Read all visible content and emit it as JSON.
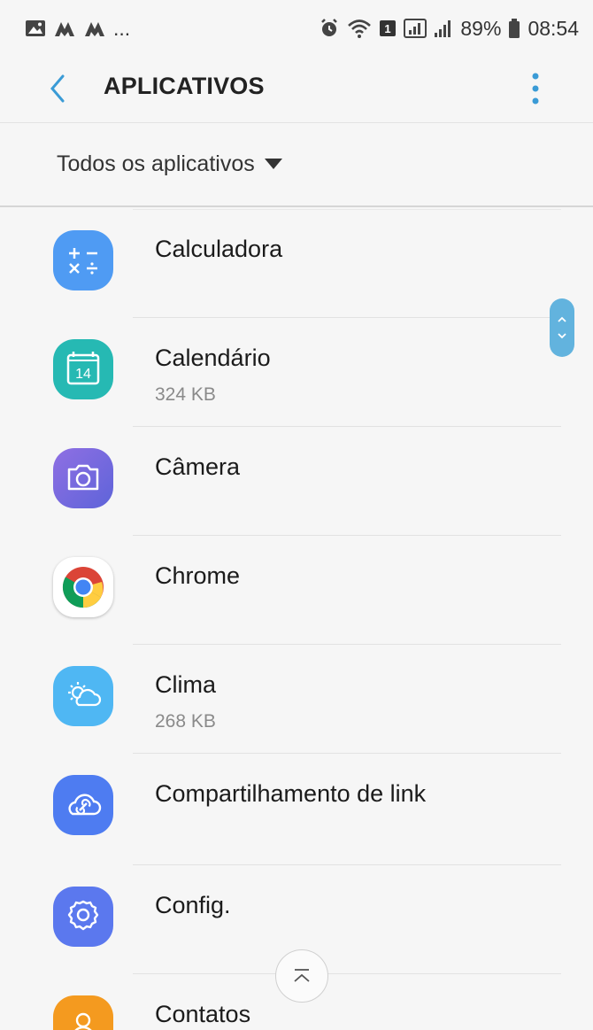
{
  "status_bar": {
    "left_icons": [
      "gallery-icon",
      "signal-app-icon",
      "signal-app-icon",
      "more-notifications"
    ],
    "ellipsis": "...",
    "right_icons": [
      "alarm-icon",
      "wifi-icon",
      "sim-icon",
      "signal-icon",
      "signal-icon"
    ],
    "battery_percent": "89%",
    "time": "08:54"
  },
  "app_bar": {
    "title": "APLICATIVOS",
    "back_icon": "chevron-left-icon",
    "menu_icon": "more-vertical-icon"
  },
  "filter": {
    "label": "Todos os aplicativos",
    "icon": "dropdown-triangle-icon"
  },
  "apps": [
    {
      "name": "Calculadora",
      "size": "",
      "icon": "calculator-icon",
      "color": "#4f9bf3"
    },
    {
      "name": "Calendário",
      "size": "324 KB",
      "icon": "calendar-icon",
      "color": "#26b9b3"
    },
    {
      "name": "Câmera",
      "size": "",
      "icon": "camera-icon",
      "color": "#7b5fd7"
    },
    {
      "name": "Chrome",
      "size": "",
      "icon": "chrome-icon",
      "color": "#ffffff"
    },
    {
      "name": "Clima",
      "size": "268 KB",
      "icon": "weather-icon",
      "color": "#4fb7f3"
    },
    {
      "name": "Compartilhamento de link",
      "size": "",
      "icon": "link-sharing-icon",
      "color": "#4e7cf1"
    },
    {
      "name": "Config.",
      "size": "",
      "icon": "settings-icon",
      "color": "#5b78ee"
    },
    {
      "name": "Contatos",
      "size": "",
      "icon": "contacts-icon",
      "color": "#f49a1f"
    }
  ],
  "colors": {
    "accent": "#3a9bd6",
    "background": "#f6f6f6"
  }
}
